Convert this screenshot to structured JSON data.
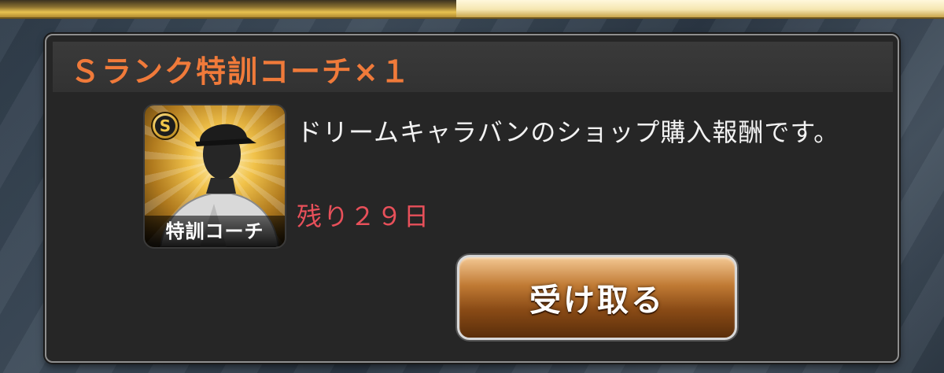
{
  "reward": {
    "title": "Ｓランク特訓コーチ×１",
    "item_label": "特訓コーチ",
    "rank_letter": "S",
    "description": "ドリームキャラバンのショップ購入報酬です。",
    "remaining": "残り２９日",
    "receive_label": "受け取る",
    "icon": "coach-card-icon"
  },
  "colors": {
    "title": "#f07a3a",
    "remaining": "#e8505a",
    "button_top": "#f3c792",
    "button_bottom": "#5a2e0a",
    "panel_bg": "#262626"
  }
}
